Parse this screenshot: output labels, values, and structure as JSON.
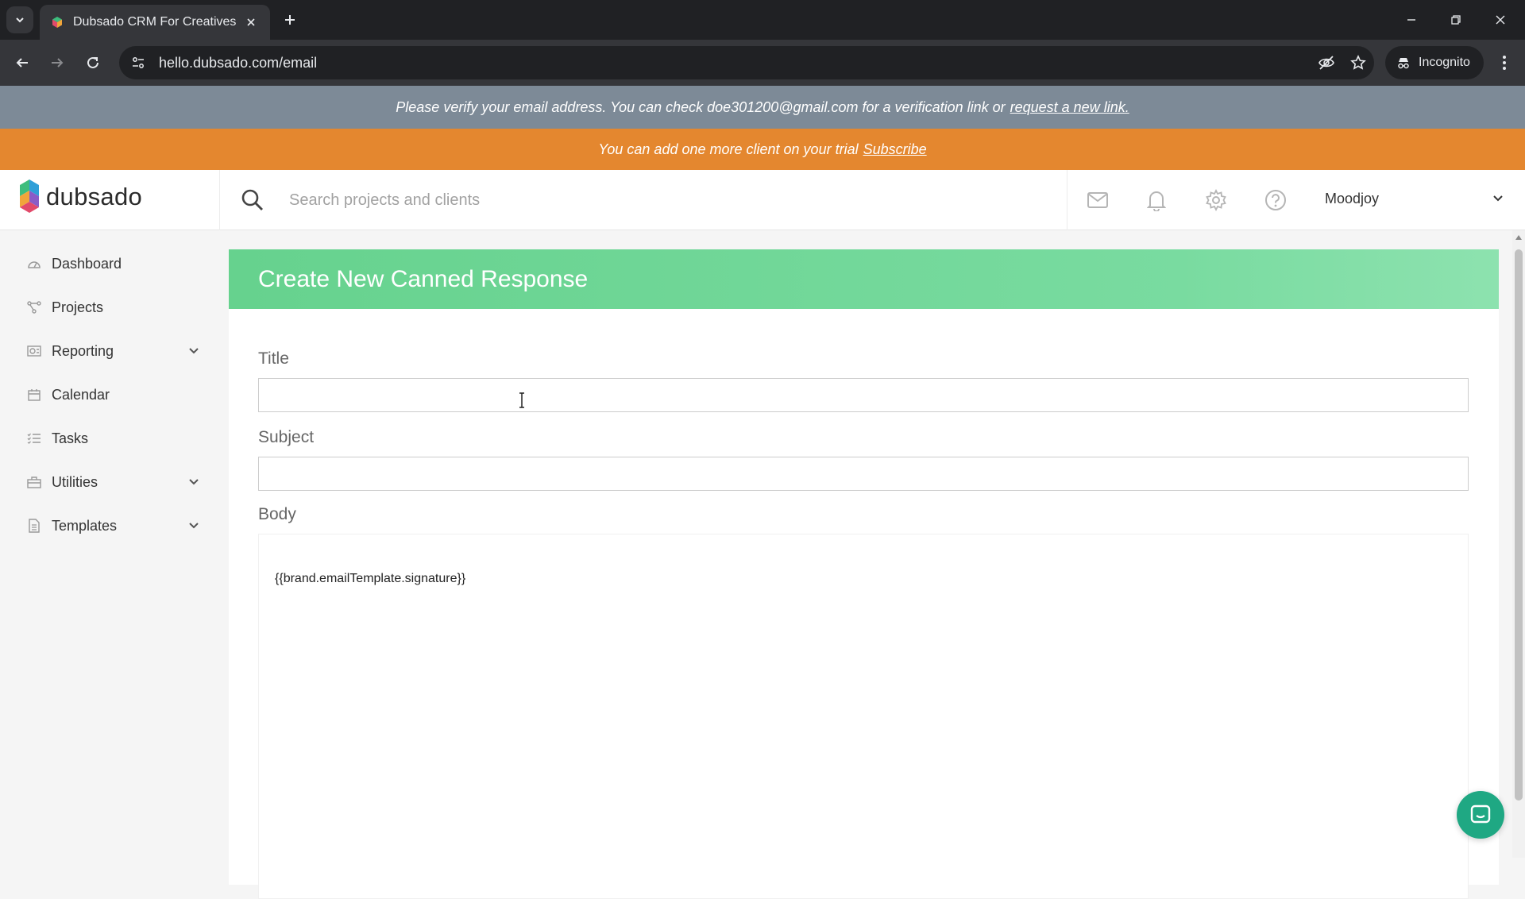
{
  "browser": {
    "tab_title": "Dubsado CRM For Creatives",
    "url": "hello.dubsado.com/email",
    "incognito_label": "Incognito"
  },
  "banners": {
    "verify_text": "Please verify your email address. You can check doe301200@gmail.com for a verification link or",
    "verify_link": "request a new link.",
    "trial_text": "You can add one more client on your trial",
    "trial_link": "Subscribe"
  },
  "header": {
    "logo_text": "dubsado",
    "search_placeholder": "Search projects and clients",
    "user_name": "Moodjoy",
    "icons": [
      "mail-icon",
      "bell-icon",
      "gear-icon",
      "help-icon"
    ]
  },
  "sidebar": {
    "items": [
      {
        "label": "Dashboard",
        "icon": "dashboard-icon",
        "expandable": false
      },
      {
        "label": "Projects",
        "icon": "projects-icon",
        "expandable": false
      },
      {
        "label": "Reporting",
        "icon": "reporting-icon",
        "expandable": true
      },
      {
        "label": "Calendar",
        "icon": "calendar-icon",
        "expandable": false
      },
      {
        "label": "Tasks",
        "icon": "tasks-icon",
        "expandable": false
      },
      {
        "label": "Utilities",
        "icon": "utilities-icon",
        "expandable": true
      },
      {
        "label": "Templates",
        "icon": "templates-icon",
        "expandable": true
      }
    ]
  },
  "form": {
    "heading": "Create New Canned Response",
    "title_label": "Title",
    "title_value": "",
    "subject_label": "Subject",
    "subject_value": "",
    "body_label": "Body",
    "body_value": "{{brand.emailTemplate.signature}}"
  },
  "colors": {
    "verify_banner": "#7d8a97",
    "trial_banner": "#e4872f",
    "card_header": "#66d28e",
    "chat_button": "#1fa883"
  }
}
